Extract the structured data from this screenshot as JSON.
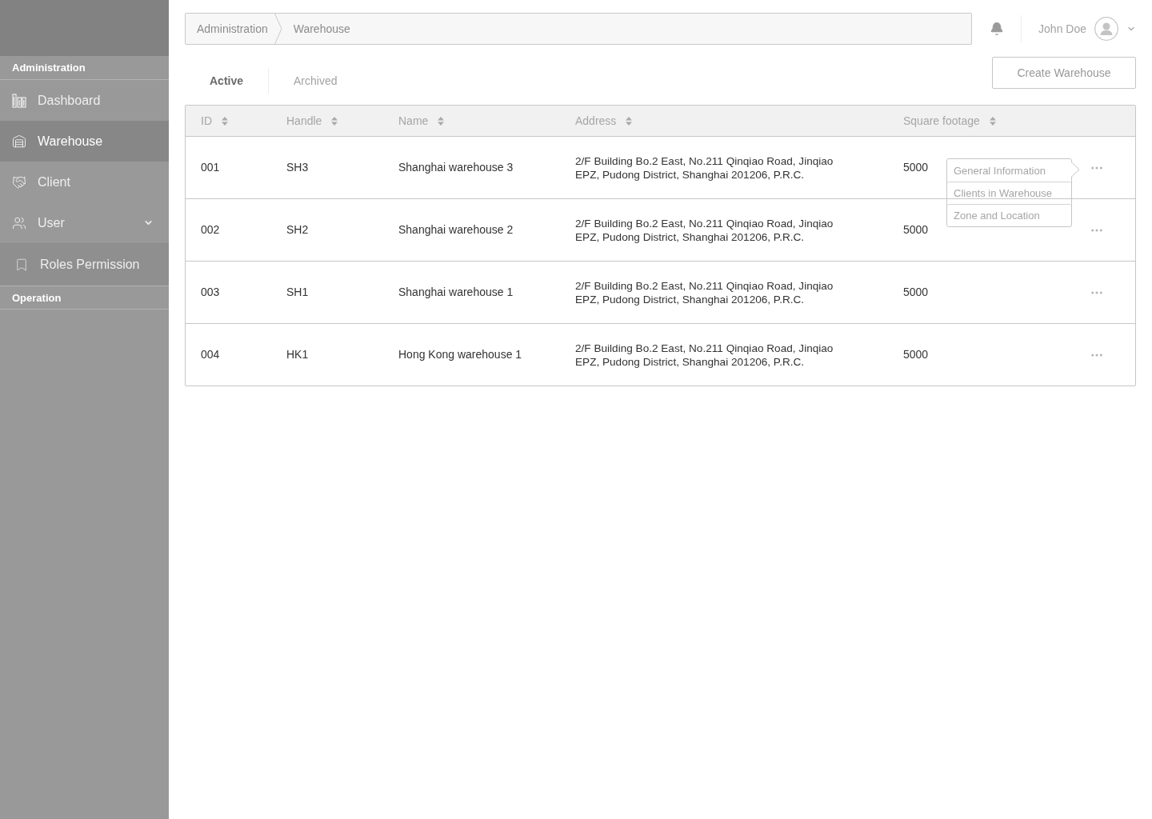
{
  "sidebar": {
    "sections": [
      {
        "title": "Administration",
        "items": [
          {
            "label": "Dashboard",
            "selected": false
          },
          {
            "label": "Warehouse",
            "selected": true
          },
          {
            "label": "Client",
            "selected": false
          },
          {
            "label": "User",
            "selected": false,
            "expanded": true,
            "children": [
              {
                "label": "Roles Permission",
                "selected": false
              }
            ]
          }
        ]
      },
      {
        "title": "Operation"
      }
    ]
  },
  "breadcrumb": [
    "Administration",
    "Warehouse"
  ],
  "user": {
    "name": "John Doe"
  },
  "tabs": [
    {
      "label": "Active",
      "selected": true
    },
    {
      "label": "Archived",
      "selected": false
    }
  ],
  "create_button": "Create Warehouse",
  "table": {
    "columns": [
      "ID",
      "Handle",
      "Name",
      "Address",
      "Square footage"
    ],
    "rows": [
      {
        "id": "001",
        "handle": "SH3",
        "name": "Shanghai warehouse 3",
        "address": "2/F Building Bo.2 East, No.211 Qinqiao Road, Jinqiao EPZ, Pudong District, Shanghai 201206, P.R.C.",
        "square_footage": "5000",
        "menu_open": true
      },
      {
        "id": "002",
        "handle": "SH2",
        "name": "Shanghai warehouse 2",
        "address": "2/F Building Bo.2 East, No.211 Qinqiao Road, Jinqiao EPZ, Pudong District, Shanghai 201206, P.R.C.",
        "square_footage": "5000",
        "menu_open": false
      },
      {
        "id": "003",
        "handle": "SH1",
        "name": "Shanghai warehouse 1",
        "address": "2/F Building Bo.2 East, No.211 Qinqiao Road, Jinqiao EPZ, Pudong District, Shanghai 201206, P.R.C.",
        "square_footage": "5000",
        "menu_open": false
      },
      {
        "id": "004",
        "handle": "HK1",
        "name": "Hong Kong warehouse 1",
        "address": "2/F Building Bo.2 East, No.211 Qinqiao Road, Jinqiao EPZ, Pudong District, Shanghai 201206, P.R.C.",
        "square_footage": "5000",
        "menu_open": false
      }
    ],
    "row_menu": [
      "General Information",
      "Clients in Warehouse",
      "Zone and Location"
    ]
  }
}
